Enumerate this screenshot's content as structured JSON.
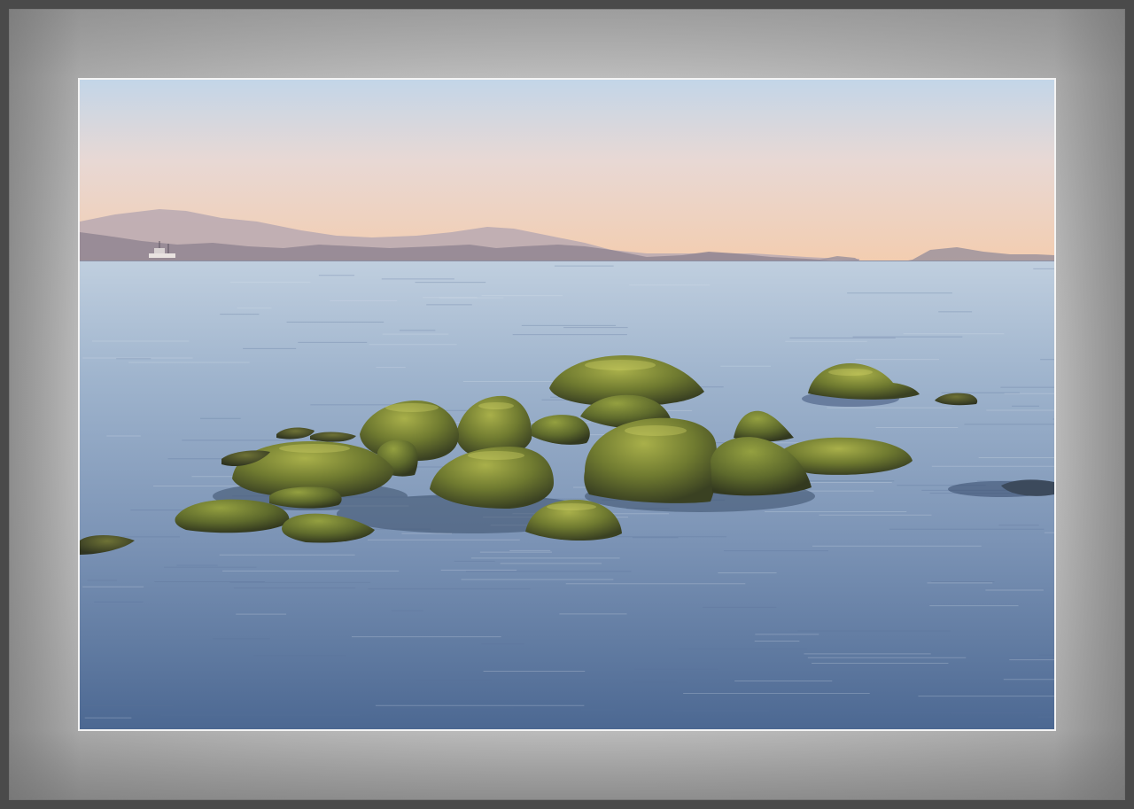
{
  "scene": {
    "subject": "",
    "colors": {
      "frame": "#4a4a4a",
      "mat_light": "#e2e2e2",
      "mat_dark": "#9e9e9e",
      "sky_top": "#c9d8e6",
      "sky_horizon": "#f2cfb2",
      "mountain": "#9a8f98",
      "water_top": "#b9c8d9",
      "water_bottom": "#4f6c93",
      "rock_moss": "#7c8a3a",
      "rock_shadow": "#3e4424"
    }
  }
}
